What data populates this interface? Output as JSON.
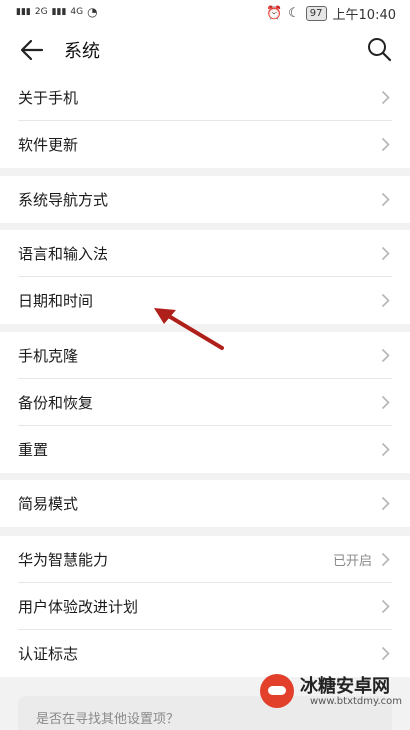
{
  "status_bar": {
    "signal1": "2G",
    "signal2": "4G",
    "battery": "97",
    "time": "上午10:40"
  },
  "header": {
    "title": "系统"
  },
  "groups": [
    {
      "items": [
        {
          "label": "关于手机"
        },
        {
          "label": "软件更新"
        }
      ]
    },
    {
      "items": [
        {
          "label": "系统导航方式"
        }
      ]
    },
    {
      "items": [
        {
          "label": "语言和输入法"
        },
        {
          "label": "日期和时间"
        }
      ]
    },
    {
      "items": [
        {
          "label": "手机克隆"
        },
        {
          "label": "备份和恢复"
        },
        {
          "label": "重置"
        }
      ]
    },
    {
      "items": [
        {
          "label": "简易模式"
        }
      ]
    },
    {
      "items": [
        {
          "label": "华为智慧能力",
          "value": "已开启"
        },
        {
          "label": "用户体验改进计划"
        },
        {
          "label": "认证标志"
        }
      ]
    }
  ],
  "footer": {
    "text": "是否在寻找其他设置项？"
  },
  "watermark": {
    "name": "冰糖安卓网",
    "url": "www.btxtdmy.com"
  }
}
